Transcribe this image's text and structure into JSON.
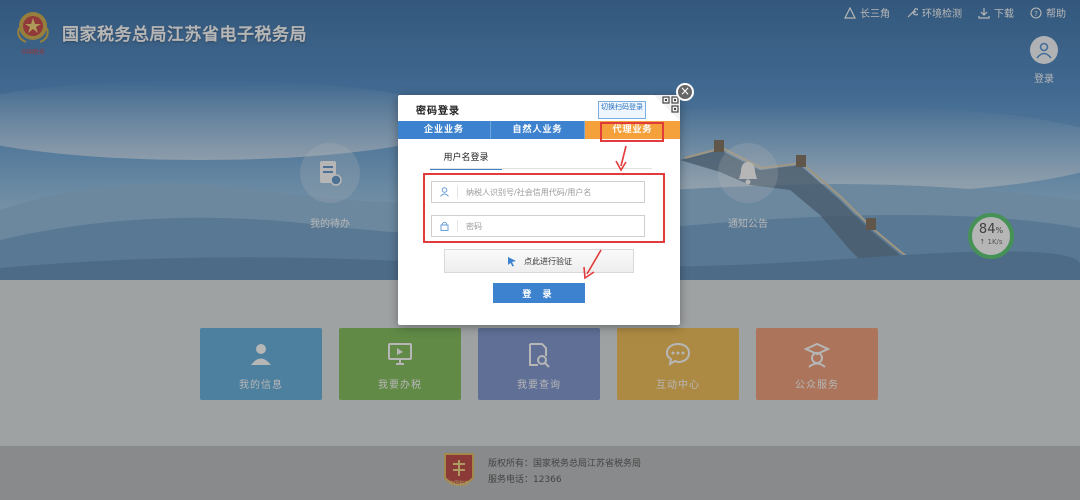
{
  "header": {
    "site_title": "国家税务总局江苏省电子税务局",
    "emblem_caption": "中国税务",
    "links": [
      {
        "label": "长三角",
        "icon": "triangle-icon"
      },
      {
        "label": "环境检测",
        "icon": "wrench-icon"
      },
      {
        "label": "下载",
        "icon": "download-icon"
      },
      {
        "label": "帮助",
        "icon": "help-icon"
      }
    ],
    "user_login_label": "登录"
  },
  "hero": {
    "todo_label": "我的待办",
    "notice_label": "通知公告",
    "speed": {
      "percent": "84",
      "percent_unit": "%",
      "rate": "↑ 1K/s"
    }
  },
  "tiles": [
    {
      "label": "我的信息",
      "color": "#4aa0d6",
      "icon": "person-icon"
    },
    {
      "label": "我要办税",
      "color": "#6cb33e",
      "icon": "monitor-icon"
    },
    {
      "label": "我要查询",
      "color": "#6a86c9",
      "icon": "search-doc-icon"
    },
    {
      "label": "互动中心",
      "color": "#f0b33a",
      "icon": "chat-icon"
    },
    {
      "label": "公众服务",
      "color": "#ec8d62",
      "icon": "graduate-icon"
    }
  ],
  "footer": {
    "copyright": "版权所有：国家税务总局江苏省税务局",
    "hotline": "服务电话：12366",
    "badge_caption": "中国税务"
  },
  "modal": {
    "title": "密码登录",
    "switch_qr_label": "切换扫码登录",
    "tabs": [
      "企业业务",
      "自然人业务",
      "代理业务"
    ],
    "active_tab": "代理业务",
    "sub_tab": "用户名登录",
    "username_placeholder": "纳税人识别号/社会信用代码/用户名",
    "password_placeholder": "密码",
    "verify_label": "点此进行验证",
    "login_label": "登 录",
    "close_label": "×"
  },
  "colors": {
    "brand_blue": "#3d82cf",
    "tab_orange": "#f4a13c",
    "annotation_red": "#e23b3b"
  }
}
